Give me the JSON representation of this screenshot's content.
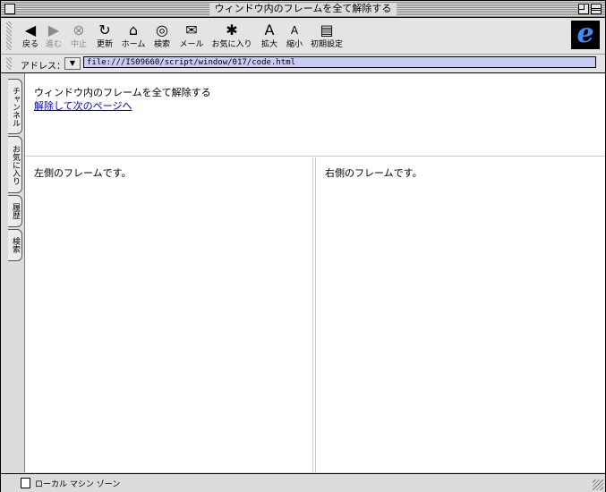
{
  "window": {
    "title": "ウィンドウ内のフレームを全て解除する"
  },
  "toolbar": {
    "buttons": [
      {
        "label": "戻る",
        "icon": "back-arrow-icon",
        "glyph": "◀",
        "enabled": true
      },
      {
        "label": "進む",
        "icon": "forward-arrow-icon",
        "glyph": "▶",
        "enabled": false
      },
      {
        "label": "中止",
        "icon": "stop-icon",
        "glyph": "⊗",
        "enabled": false
      },
      {
        "label": "更新",
        "icon": "refresh-icon",
        "glyph": "↻",
        "enabled": true
      },
      {
        "label": "ホーム",
        "icon": "home-icon",
        "glyph": "⌂",
        "enabled": true
      },
      {
        "label": "検索",
        "icon": "search-icon",
        "glyph": "◎",
        "enabled": true
      },
      {
        "label": "メール",
        "icon": "mail-icon",
        "glyph": "✉",
        "enabled": true
      },
      {
        "label": "お気に入り",
        "icon": "favorites-icon",
        "glyph": "✱",
        "enabled": true
      },
      {
        "label": "拡大",
        "icon": "text-larger-icon",
        "glyph": "A",
        "enabled": true
      },
      {
        "label": "縮小",
        "icon": "text-smaller-icon",
        "glyph": "A",
        "enabled": true
      },
      {
        "label": "初期設定",
        "icon": "preferences-icon",
        "glyph": "▤",
        "enabled": true
      }
    ],
    "logo": "e"
  },
  "address": {
    "label": "アドレス：",
    "url": "file:///IS09660/script/window/017/code.html"
  },
  "sidetabs": [
    "チャンネル",
    "お気に入り",
    "履歴",
    "検索"
  ],
  "content": {
    "top_frame": {
      "heading": "ウィンドウ内のフレームを全て解除する",
      "link": "解除して次のページへ"
    },
    "left_frame": {
      "text": "左側のフレームです。"
    },
    "right_frame": {
      "text": "右側のフレームです。"
    }
  },
  "status": {
    "text": "ローカル マシン ゾーン"
  },
  "colors": {
    "link": "#0000cc",
    "address_bg": "#c8ccf4"
  }
}
